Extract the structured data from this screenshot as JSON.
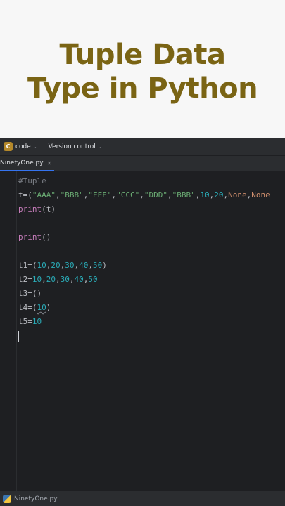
{
  "title": {
    "line1": "Tuple Data",
    "line2": "Type in Python"
  },
  "toolbar": {
    "project_badge": "C",
    "project_name": "code",
    "vcs_label": "Version control",
    "chevron": "⌄"
  },
  "tab": {
    "filename": "NinetyOne.py",
    "close": "✕"
  },
  "code_lines": {
    "l1": "#Tuple",
    "l2": {
      "t": "t=(",
      "s1": "\"AAA\"",
      "c1": ",",
      "s2": "\"BBB\"",
      "c2": ",",
      "s3": "\"EEE\"",
      "c3": ",",
      "s4": "\"CCC\"",
      "c4": ",",
      "s5": "\"DDD\"",
      "c5": ",",
      "s6": "\"BBB\"",
      "c6": ",",
      "n1": "10",
      "c7": ",",
      "n2": "20",
      "c8": ",",
      "k1": "None",
      "c9": ",",
      "k2": "None"
    },
    "l3": {
      "fn": "print",
      "rest": "(t)"
    },
    "l5": {
      "fn": "print",
      "rest": "()"
    },
    "l7": {
      "a": "t1=(",
      "n1": "10",
      "n2": "20",
      "n3": "30",
      "n4": "40",
      "n5": "50",
      "close": ")"
    },
    "l8": {
      "a": "t2=",
      "n1": "10",
      "n2": "20",
      "n3": "30",
      "n4": "40",
      "n5": "50"
    },
    "l9": "t3=()",
    "l10": {
      "a": "t4=(",
      "n1": "10",
      "close": ")"
    },
    "l11": {
      "a": "t5=",
      "n1": "10"
    }
  },
  "statusbar": {
    "file": "NinetyOne.py"
  },
  "colors": {
    "title": "#7a6414",
    "editor_bg": "#1e1f22",
    "string": "#6aab73",
    "number": "#2aacb8",
    "keyword": "#cf8e6d",
    "builtin": "#c77dbb",
    "comment": "#7a7e85"
  },
  "icons": {
    "project": "project-badge-icon",
    "python": "python-file-icon"
  }
}
